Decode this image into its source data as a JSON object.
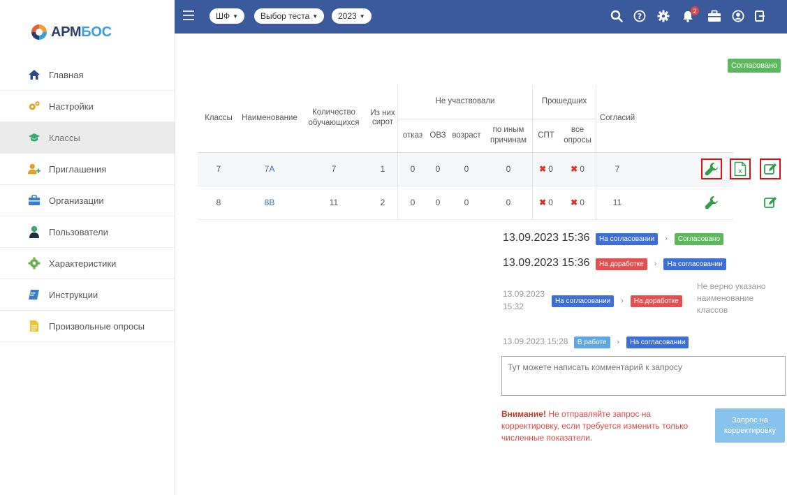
{
  "app": {
    "logo_part1": "АРМ",
    "logo_part2": "БОС"
  },
  "sidebar": {
    "items": [
      {
        "label": "Главная",
        "icon": "home-icon"
      },
      {
        "label": "Настройки",
        "icon": "gears-icon"
      },
      {
        "label": "Классы",
        "icon": "graduation-cap-icon"
      },
      {
        "label": "Приглашения",
        "icon": "user-plus-icon"
      },
      {
        "label": "Организации",
        "icon": "briefcase-icon"
      },
      {
        "label": "Пользователи",
        "icon": "user-icon"
      },
      {
        "label": "Характеристики",
        "icon": "gear-icon"
      },
      {
        "label": "Инструкции",
        "icon": "book-icon"
      },
      {
        "label": "Произвольные опросы",
        "icon": "document-icon"
      }
    ]
  },
  "topbar": {
    "filter1": "ШФ",
    "filter2": "Выбор теста",
    "filter3": "2023",
    "notifications_count": "2"
  },
  "status_top": "Согласовано",
  "table": {
    "headers": {
      "classes": "Классы",
      "name": "Наименование",
      "count": "Количество обучающихся",
      "orphans": "Из них сирот",
      "not_participated": "Не участвовали",
      "refusal": "отказ",
      "ovz": "ОВЗ",
      "age": "возраст",
      "other": "по иным причинам",
      "passed": "Прошедших",
      "spt": "СПТ",
      "all_surveys": "все опросы",
      "consents": "Согласий"
    },
    "rows": [
      {
        "class": "7",
        "name": "7А",
        "count": "7",
        "orphans": "1",
        "refusal": "0",
        "ovz": "0",
        "age": "0",
        "other": "0",
        "spt": "0",
        "all": "0",
        "consents": "7"
      },
      {
        "class": "8",
        "name": "8В",
        "count": "11",
        "orphans": "2",
        "refusal": "0",
        "ovz": "0",
        "age": "0",
        "other": "0",
        "spt": "0",
        "all": "0",
        "consents": "11"
      }
    ]
  },
  "history": [
    {
      "date": "13.09.2023 15:36",
      "from": "На согласовании",
      "to": "Согласовано",
      "note": ""
    },
    {
      "date": "13.09.2023 15:36",
      "from": "На доработке",
      "to": "На согласовании",
      "note": ""
    },
    {
      "date_line1": "13.09.2023",
      "date_line2": "15:32",
      "from": "На согласовании",
      "to": "На доработке",
      "note": "Не верно указано наименование классов"
    },
    {
      "date": "13.09.2023 15:28",
      "from": "В работе",
      "to": "На согласовании",
      "note": ""
    }
  ],
  "comment": {
    "placeholder": "Тут можете написать комментарий к запросу"
  },
  "warning": {
    "strong": "Внимание!",
    "text": " Не отправляйте запрос на корректировку, если требуется изменить только численные показатели."
  },
  "request_button": "Запрос на корректировку",
  "colors": {
    "topbar": "#3a5a9c",
    "success": "#5cb85c",
    "info": "#3d6fd6",
    "danger": "#e45050",
    "highlight": "#e10f0f"
  }
}
